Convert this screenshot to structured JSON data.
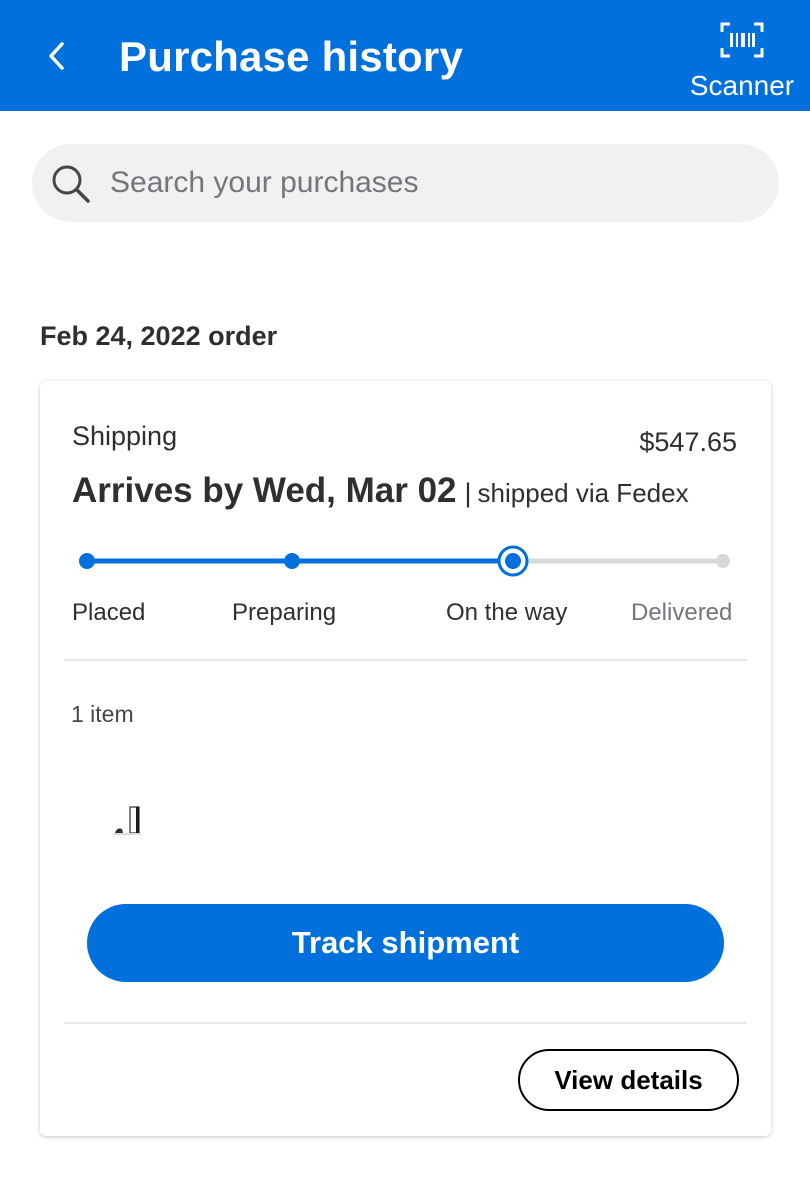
{
  "header": {
    "title": "Purchase history",
    "scanner_label": "Scanner",
    "background": "#0071dc"
  },
  "search": {
    "placeholder": "Search your purchases",
    "value": ""
  },
  "order": {
    "date_heading": "Feb 24, 2022 order",
    "status_label": "Shipping",
    "total": "$547.65",
    "arrival": "Arrives by Wed, Mar 02",
    "separator": "|",
    "carrier": "shipped via Fedex",
    "progress": {
      "current_step_index": 2,
      "steps": [
        {
          "label": "Placed",
          "state": "complete"
        },
        {
          "label": "Preparing",
          "state": "complete"
        },
        {
          "label": "On the way",
          "state": "current"
        },
        {
          "label": "Delivered",
          "state": "pending"
        }
      ],
      "active_color": "#0071dc",
      "inactive_color": "#d9d9da"
    },
    "item_count": "1 item",
    "items": [
      {
        "icon": "console-product-image"
      }
    ],
    "track_button_label": "Track shipment",
    "details_button_label": "View details"
  }
}
